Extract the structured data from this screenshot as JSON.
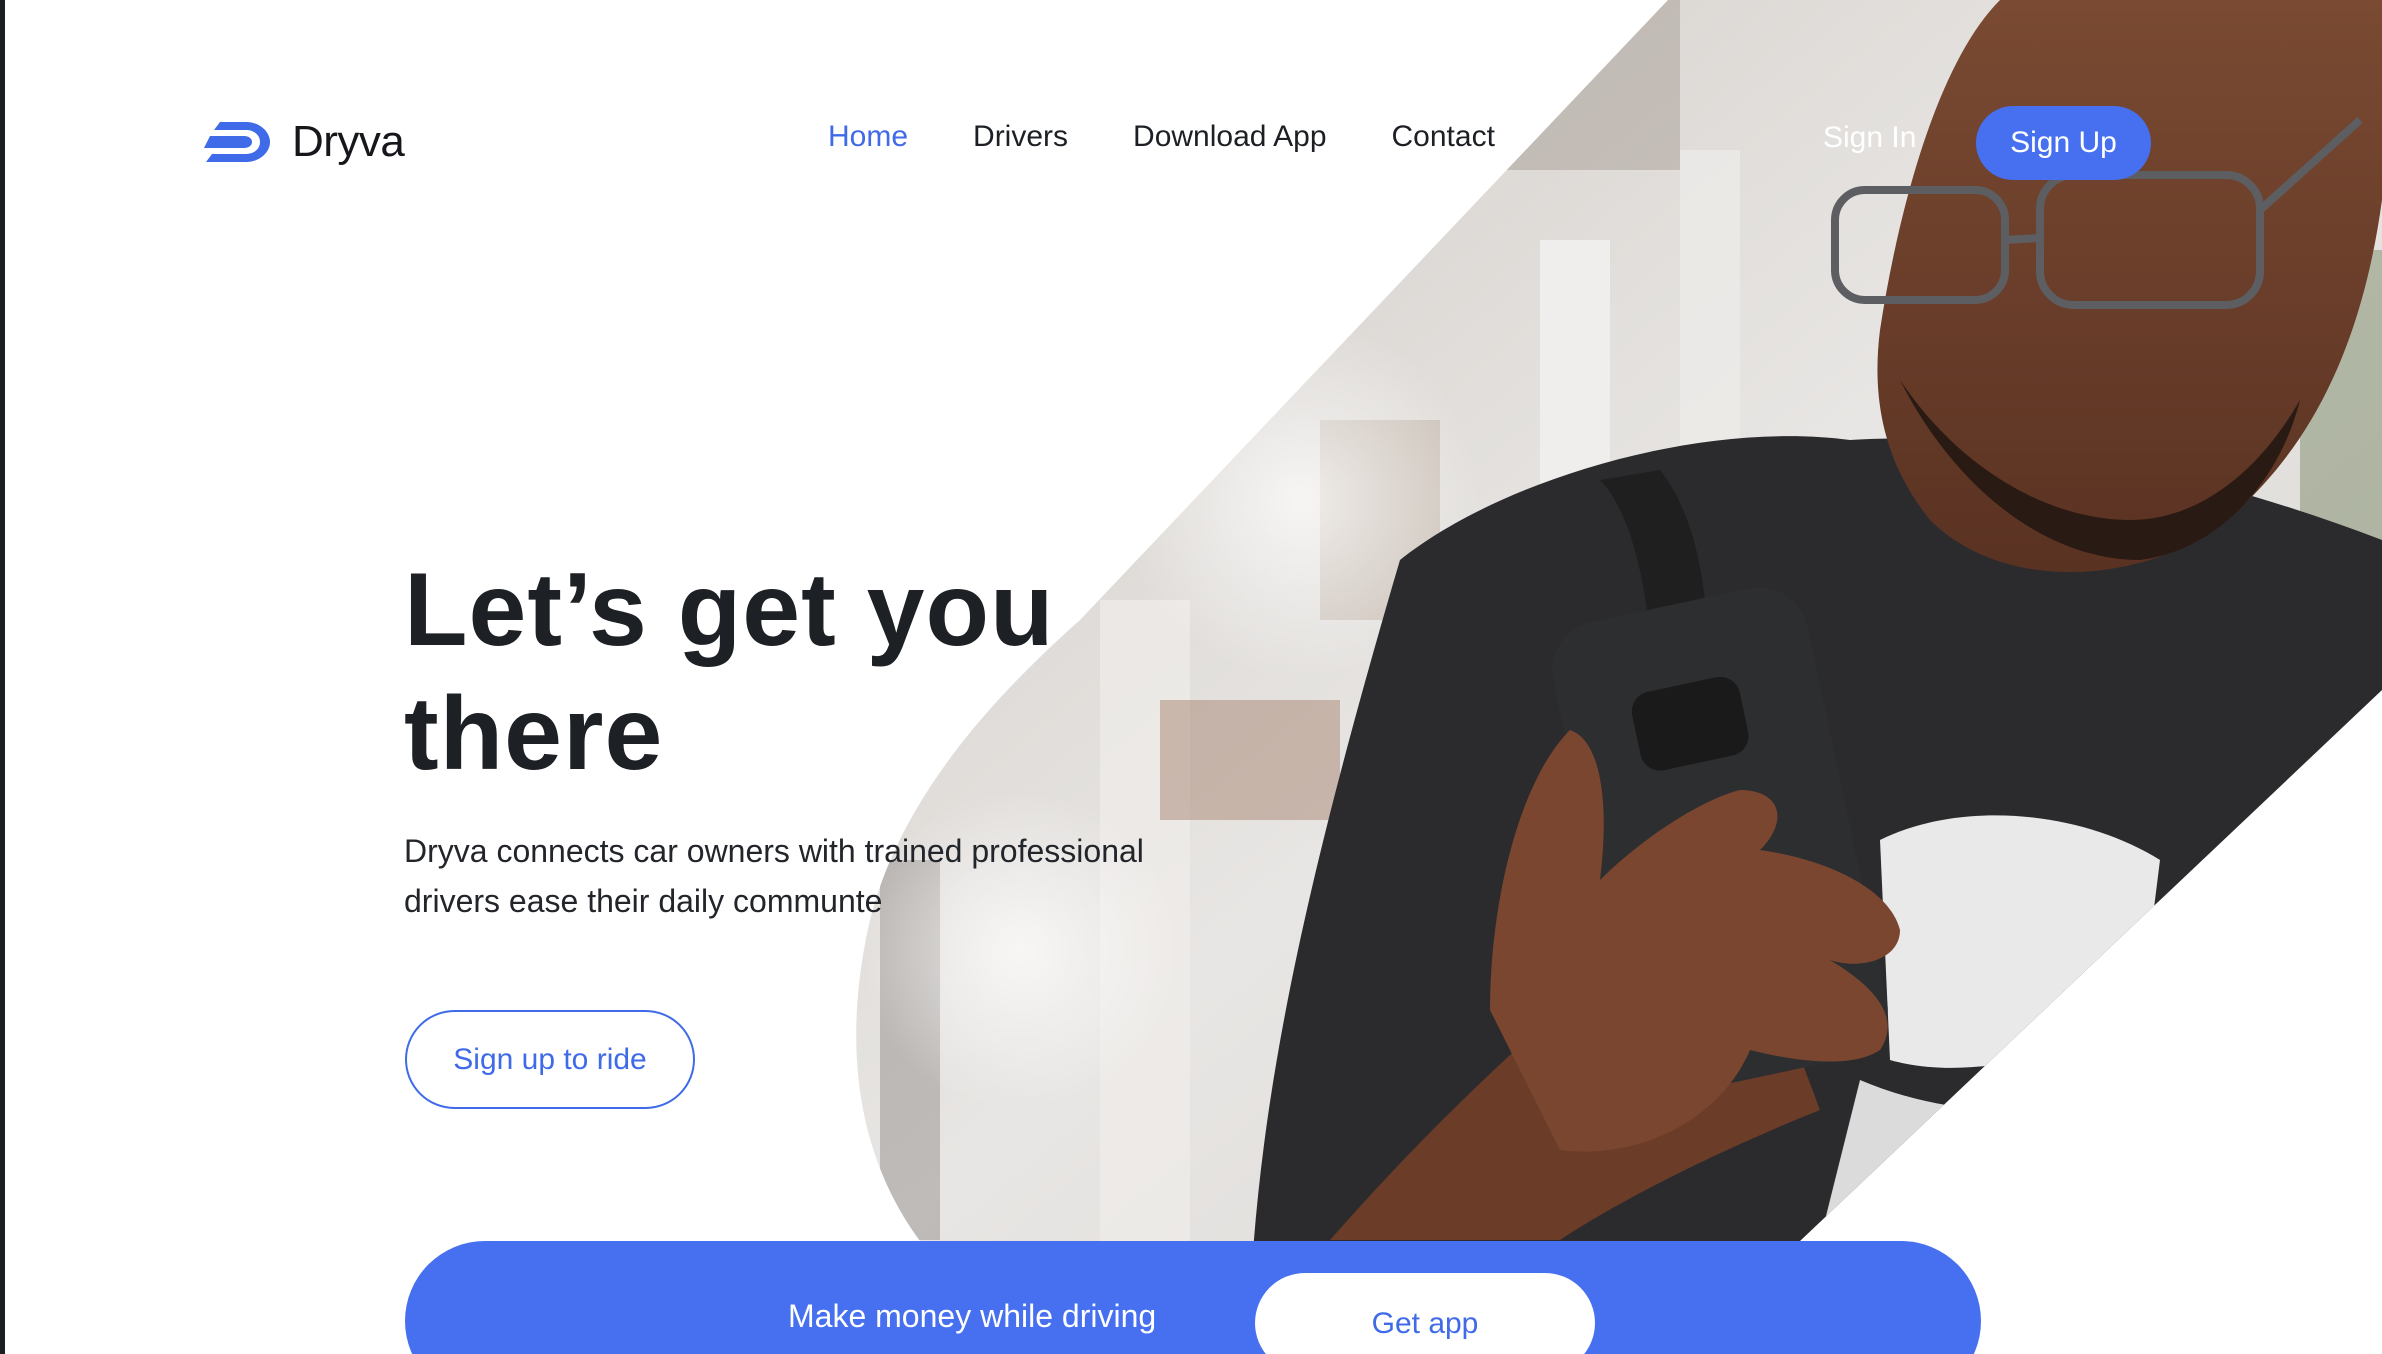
{
  "brand": {
    "name": "Dryva",
    "accent": "#4670f0"
  },
  "nav": {
    "items": [
      {
        "label": "Home",
        "active": true
      },
      {
        "label": "Drivers",
        "active": false
      },
      {
        "label": "Download App",
        "active": false
      },
      {
        "label": "Contact",
        "active": false
      }
    ]
  },
  "auth": {
    "signin_label": "Sign In",
    "signup_label": "Sign Up"
  },
  "hero": {
    "headline_line1": "Let’s get you",
    "headline_line2": "there",
    "subtext_line1": "Dryva connects car owners with trained professional",
    "subtext_line2": "drivers ease their daily communte",
    "cta_label": "Sign up to ride"
  },
  "banner": {
    "text": "Make money while driving",
    "button_label": "Get app"
  }
}
